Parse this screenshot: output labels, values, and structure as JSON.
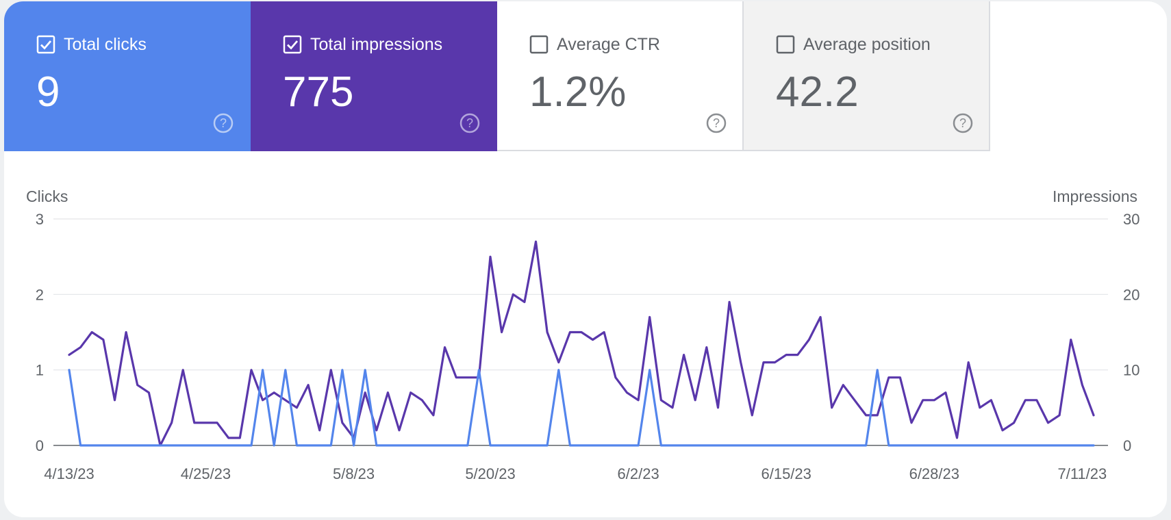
{
  "tiles": [
    {
      "label": "Total clicks",
      "value": "9",
      "checked": true,
      "bg": "#5385ec"
    },
    {
      "label": "Total impressions",
      "value": "775",
      "checked": true,
      "bg": "#5937ab"
    },
    {
      "label": "Average CTR",
      "value": "1.2%",
      "checked": false,
      "bg": "#ffffff"
    },
    {
      "label": "Average position",
      "value": "42.2",
      "checked": false,
      "bg": "#f2f2f2"
    }
  ],
  "chart_data": {
    "type": "line",
    "left_axis_label": "Clicks",
    "right_axis_label": "Impressions",
    "left_ticks": [
      "0",
      "1",
      "2",
      "3"
    ],
    "right_ticks": [
      "0",
      "10",
      "20",
      "30"
    ],
    "ylim_left": [
      0,
      3
    ],
    "ylim_right": [
      0,
      30
    ],
    "x_tick_labels": [
      "4/13/23",
      "4/25/23",
      "5/8/23",
      "5/20/23",
      "6/2/23",
      "6/15/23",
      "6/28/23",
      "7/11/23"
    ],
    "x_tick_indices": [
      0,
      12,
      25,
      37,
      50,
      63,
      76,
      89
    ],
    "grid": true,
    "series": [
      {
        "name": "Impressions",
        "axis": "right",
        "color": "#5937ab",
        "values": [
          12,
          13,
          15,
          14,
          6,
          15,
          8,
          7,
          0,
          3,
          10,
          3,
          3,
          3,
          1,
          1,
          10,
          6,
          7,
          6,
          5,
          8,
          2,
          10,
          3,
          1,
          7,
          2,
          7,
          2,
          7,
          6,
          4,
          13,
          9,
          9,
          9,
          25,
          15,
          20,
          19,
          27,
          15,
          11,
          15,
          15,
          14,
          15,
          9,
          7,
          6,
          17,
          6,
          5,
          12,
          6,
          13,
          5,
          19,
          11,
          4,
          11,
          11,
          12,
          12,
          14,
          17,
          5,
          8,
          6,
          4,
          4,
          9,
          9,
          3,
          6,
          6,
          7,
          1,
          11,
          5,
          6,
          2,
          3,
          6,
          6,
          3,
          4,
          14,
          8,
          4
        ]
      },
      {
        "name": "Clicks",
        "axis": "left",
        "color": "#5385ec",
        "values": [
          1,
          0,
          0,
          0,
          0,
          0,
          0,
          0,
          0,
          0,
          0,
          0,
          0,
          0,
          0,
          0,
          0,
          1,
          0,
          1,
          0,
          0,
          0,
          0,
          1,
          0,
          1,
          0,
          0,
          0,
          0,
          0,
          0,
          0,
          0,
          0,
          1,
          0,
          0,
          0,
          0,
          0,
          0,
          1,
          0,
          0,
          0,
          0,
          0,
          0,
          0,
          1,
          0,
          0,
          0,
          0,
          0,
          0,
          0,
          0,
          0,
          0,
          0,
          0,
          0,
          0,
          0,
          0,
          0,
          0,
          0,
          1,
          0,
          0,
          0,
          0,
          0,
          0,
          0,
          0,
          0,
          0,
          0,
          0,
          0,
          0,
          0,
          0,
          0,
          0,
          0
        ]
      }
    ]
  }
}
